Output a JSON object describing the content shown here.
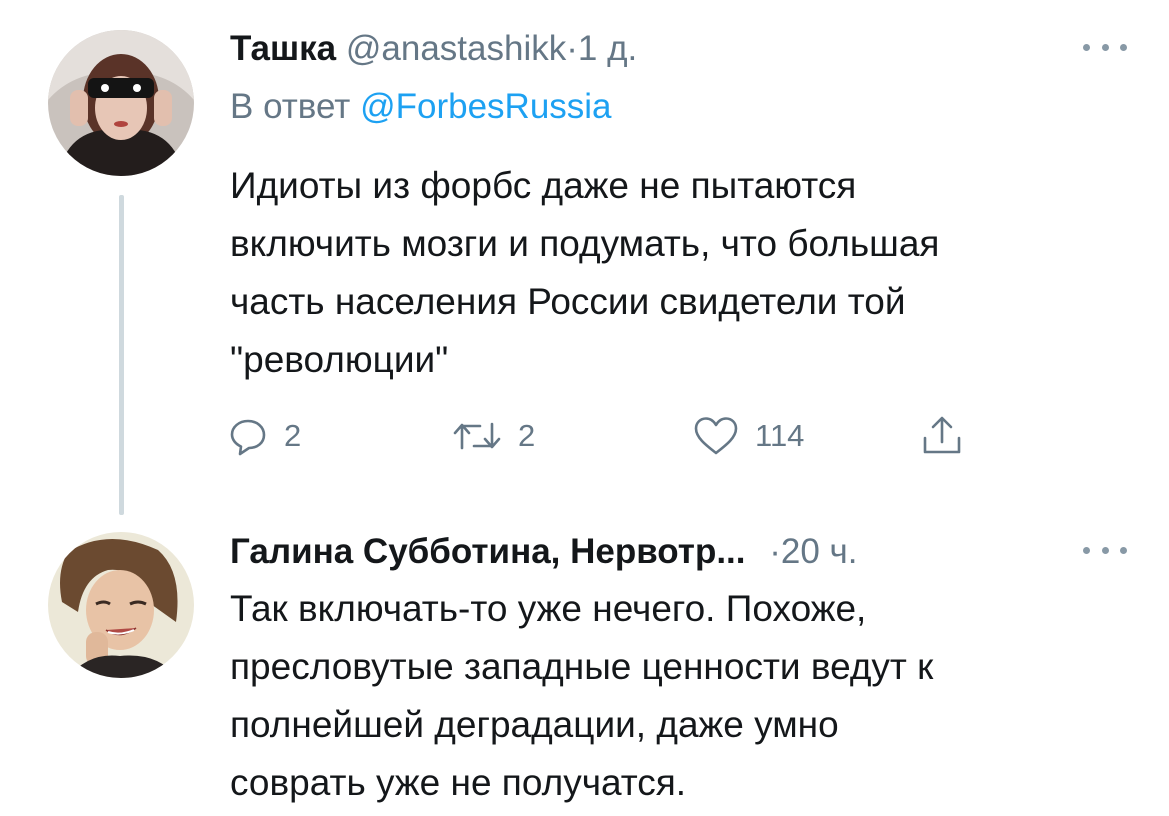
{
  "tweets": [
    {
      "display_name": "Ташка",
      "handle": "@anastashikk",
      "separator": "·",
      "time": "1 д.",
      "reply_prefix": "В ответ",
      "reply_to": "@ForbesRussia",
      "text": "Идиоты из форбс даже не пытаются\nвключить мозги и подумать, что большая\nчасть населения России свидетели той\n\"революции\"",
      "replies": "2",
      "retweets": "2",
      "likes": "114",
      "icons": {
        "reply": "reply-icon",
        "retweet": "retweet-icon",
        "like": "heart-icon",
        "share": "share-icon",
        "more": "more-icon"
      }
    },
    {
      "display_name": "Галина Субботина, Нервотр...",
      "separator": "·",
      "time": "20 ч.",
      "text": "Так включать-то уже нечего. Похоже,\nпресловутые западные ценности ведут к\nполнейшей деградации, даже умно\nсоврать уже не получатся."
    }
  ],
  "colors": {
    "text": "#14171a",
    "secondary": "#657786",
    "link": "#1da1f2",
    "thread_line": "#cfd9de"
  }
}
